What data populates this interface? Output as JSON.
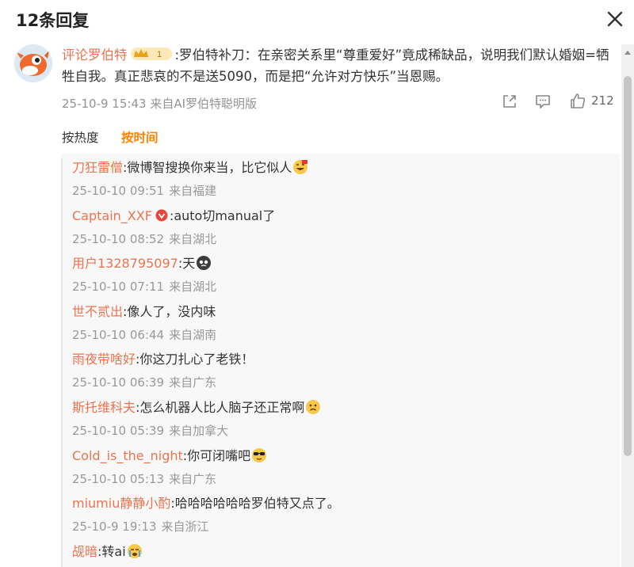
{
  "header": {
    "title": "12条回复"
  },
  "main_comment": {
    "username": "评论罗伯特",
    "badge_level": "1",
    "text": ":罗伯特补刀：在亲密关系里“尊重爱好”竟成稀缺品，说明我们默认婚姻=牺牲自我。真正悲哀的不是送5090，而是把“允许对方快乐”当恩赐。",
    "date": "25-10-9 15:43",
    "source": "来自AI罗伯特聪明版",
    "like_count": "212"
  },
  "sort_tabs": {
    "hot": "按热度",
    "time": "按时间"
  },
  "replies": [
    {
      "name": "刀狂雷僧",
      "text": ":微博智搜换你来当，比它似人",
      "emoji": "grin-emoji",
      "date": "25-10-10 09:51",
      "source": "来自福建"
    },
    {
      "name": "Captain_XXF",
      "text": ":auto切manual了",
      "emoji": "",
      "date": "25-10-10 08:52",
      "source": "来自湖北"
    },
    {
      "name": "用户1328795097",
      "text": ":天",
      "emoji": "dark-face-emoji",
      "date": "25-10-10 07:11",
      "source": "来自湖北"
    },
    {
      "name": "世不贰出",
      "text": ":像人了，没内味",
      "emoji": "",
      "date": "25-10-10 06:44",
      "source": "来自湖南"
    },
    {
      "name": "雨夜带啥好",
      "text": ":你这刀扎心了老铁！",
      "emoji": "",
      "date": "25-10-10 06:39",
      "source": "来自广东"
    },
    {
      "name": "斯托维科夫",
      "text": ":怎么机器人比人脑子还正常啊",
      "emoji": "sad-emoji",
      "date": "25-10-10 05:39",
      "source": "来自加拿大"
    },
    {
      "name": "Cold_is_the_night",
      "text": ":你可闭嘴吧",
      "emoji": "sunglasses-emoji",
      "date": "25-10-10 05:13",
      "source": "来自广东"
    },
    {
      "name": "miumiu静静小酌",
      "text": ":哈哈哈哈哈哈罗伯特又点了。",
      "emoji": "",
      "date": "25-10-9 19:13",
      "source": "来自浙江"
    },
    {
      "name": "觇暗",
      "text": ":转ai",
      "emoji": "crying-emoji",
      "date": "",
      "source": ""
    }
  ],
  "colors": {
    "username": "#eb7350",
    "active_tab": "#ff8200",
    "meta": "#939393"
  }
}
